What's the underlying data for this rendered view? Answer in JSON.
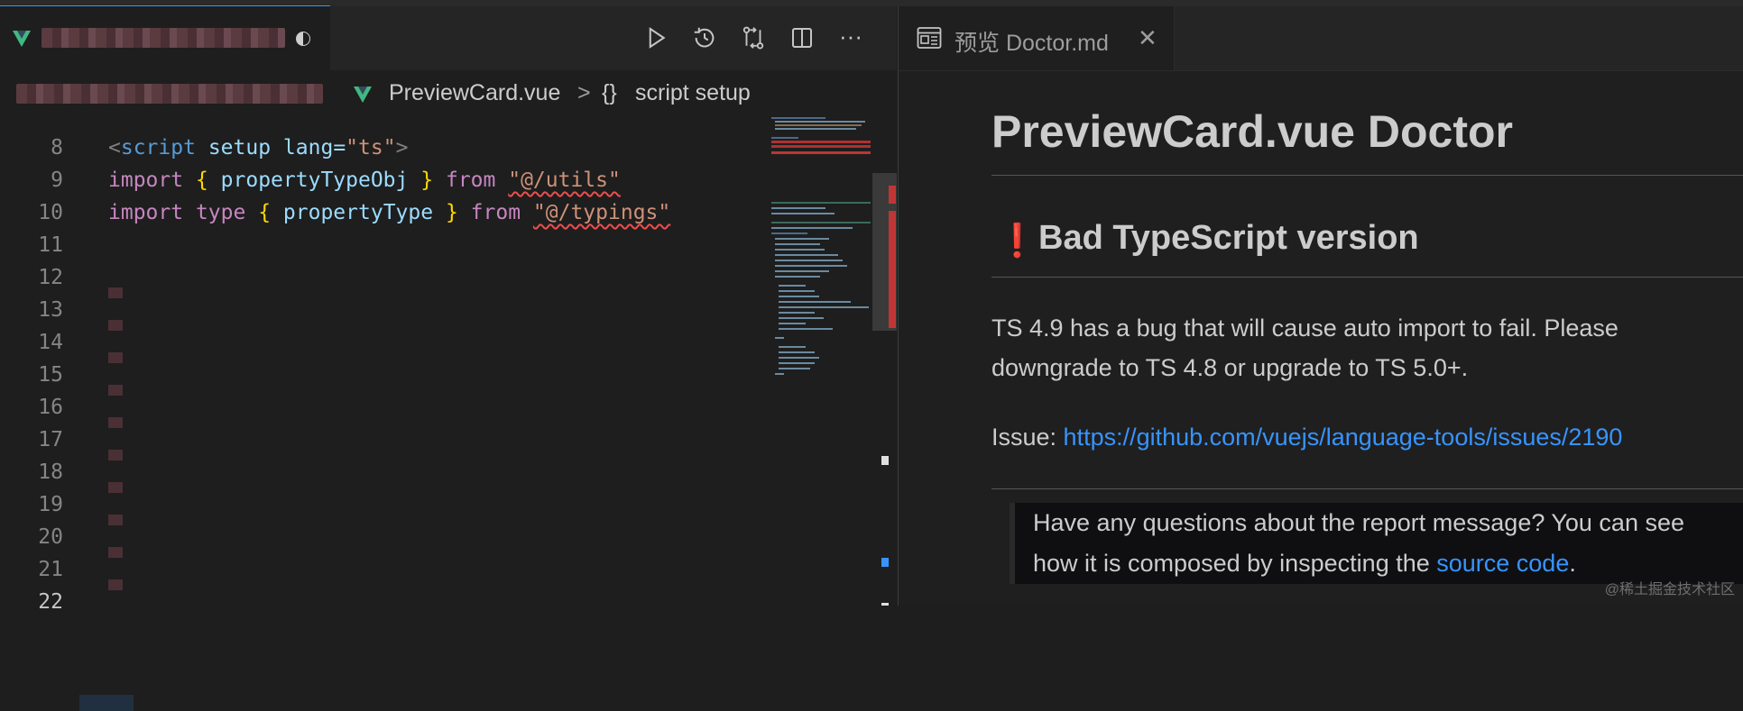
{
  "editor": {
    "breadcrumb": {
      "file": "PreviewCard.vue",
      "separator": ">",
      "braces": "{}",
      "symbol": "script setup"
    },
    "toolbar_icons": [
      "run-icon",
      "history-icon",
      "compare-changes-icon",
      "split-editor-icon",
      "more-actions-icon"
    ],
    "more_label": "···",
    "line_numbers": [
      "8",
      "9",
      "10",
      "11",
      "12",
      "13",
      "14",
      "15",
      "16",
      "17",
      "18",
      "19",
      "20",
      "21",
      "22"
    ],
    "code": {
      "l8": {
        "lt": "<",
        "tag": "script",
        "attr1": "setup",
        "attr2": "lang",
        "eq": "=",
        "val": "\"ts\"",
        "gt": ">"
      },
      "l9": {
        "kw": "import",
        "ob": "{",
        "id": "propertyTypeObj",
        "cb": "}",
        "from": "from",
        "str": "\"@/utils\""
      },
      "l10": {
        "kw": "import",
        "type": "type",
        "ob": "{",
        "id": "propertyType",
        "cb": "}",
        "from": "from",
        "str": "\"@/typings\""
      }
    }
  },
  "preview": {
    "tab_label": "预览 Doctor.md",
    "close_label": "✕",
    "h1": "PreviewCard.vue Doctor",
    "h2_mark": "❗",
    "h2": "Bad TypeScript version",
    "para1_line1": "TS 4.9 has a bug that will cause auto import to fail. Please",
    "para1_line2": "downgrade to TS 4.8 or upgrade to TS 5.0+.",
    "issue_label": "Issue: ",
    "issue_link": "https://github.com/vuejs/language-tools/issues/2190",
    "quote_line1": "Have any questions about the report message? You can see",
    "quote_line2_prefix": "how it is composed by inspecting the ",
    "quote_link": "source code",
    "quote_suffix": "."
  },
  "watermark": "@稀土掘金技术社区",
  "colors": {
    "accent": "#3794ff",
    "link": "#3794ff",
    "error": "#f14c4c",
    "vue_green": "#41b883"
  }
}
